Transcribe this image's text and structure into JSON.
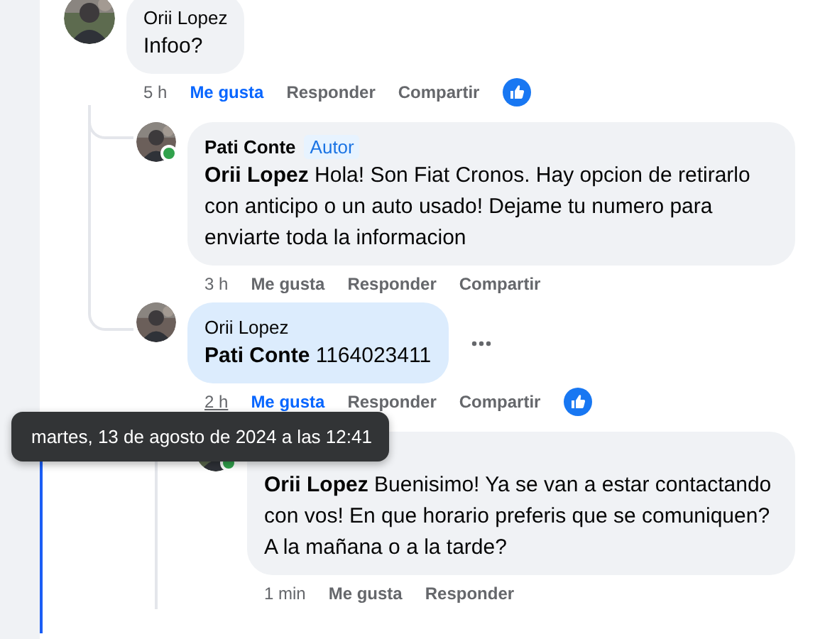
{
  "comments": [
    {
      "author": "Orii Lopez",
      "text": "Infoo?",
      "online": false,
      "highlighted": false,
      "time": "5 h",
      "time_underlined": false,
      "actions": [
        {
          "label": "Me gusta",
          "selected": true
        },
        {
          "label": "Responder",
          "selected": false
        },
        {
          "label": "Compartir",
          "selected": false
        }
      ],
      "like_reaction": true,
      "more_button": false,
      "children": [
        {
          "author": "Pati Conte",
          "badge": "Autor",
          "mention": "Orii Lopez",
          "text": "Hola! Son Fiat Cronos. Hay opcion de retirarlo con anticipo o un auto usado! Dejame tu numero para enviarte toda la informacion",
          "online": true,
          "highlighted": false,
          "time": "3 h",
          "time_underlined": false,
          "actions": [
            {
              "label": "Me gusta",
              "selected": false
            },
            {
              "label": "Responder",
              "selected": false
            },
            {
              "label": "Compartir",
              "selected": false
            }
          ],
          "like_reaction": false,
          "more_button": false
        },
        {
          "author": "Orii Lopez",
          "mention": "Pati Conte",
          "text": "1164023411",
          "online": false,
          "highlighted": true,
          "time": "2 h",
          "time_underlined": true,
          "actions": [
            {
              "label": "Me gusta",
              "selected": true
            },
            {
              "label": "Responder",
              "selected": false
            },
            {
              "label": "Compartir",
              "selected": false
            }
          ],
          "like_reaction": true,
          "more_button": true,
          "children": [
            {
              "mention": "Orii Lopez",
              "text": "Buenisimo! Ya se van a estar contactando con vos! En que horario preferis que se comuniquen? A la mañana o a la tarde?",
              "online": true,
              "highlighted": false,
              "time": "1 min",
              "time_underlined": false,
              "actions": [
                {
                  "label": "Me gusta",
                  "selected": false
                },
                {
                  "label": "Responder",
                  "selected": false
                }
              ],
              "like_reaction": false,
              "more_button": false
            }
          ]
        }
      ]
    }
  ],
  "tooltip": {
    "text": "martes, 13 de agosto de 2024 a las 12:41"
  }
}
